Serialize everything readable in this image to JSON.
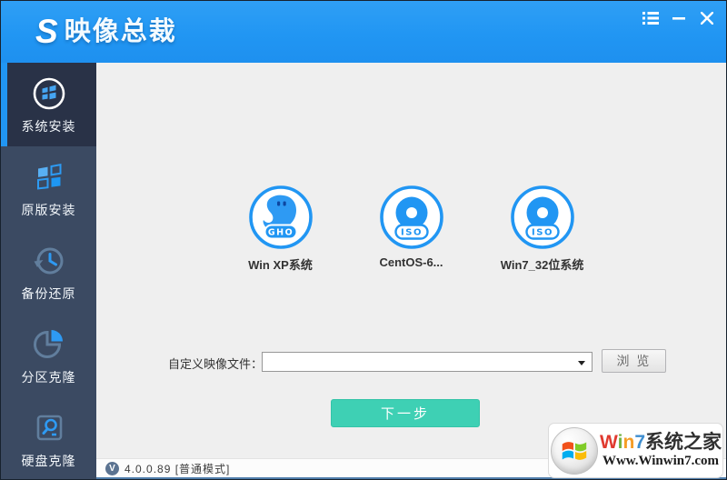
{
  "window": {
    "logo_letter": "S",
    "title": "映像总裁"
  },
  "titlebar": {
    "icons": [
      "menu-icon",
      "minimize-icon",
      "close-icon"
    ]
  },
  "sidebar": {
    "items": [
      {
        "label": "系统安装",
        "icon": "system-install-icon",
        "selected": true
      },
      {
        "label": "原版安装",
        "icon": "original-install-icon",
        "selected": false
      },
      {
        "label": "备份还原",
        "icon": "backup-restore-icon",
        "selected": false
      },
      {
        "label": "分区克隆",
        "icon": "partition-clone-icon",
        "selected": false
      },
      {
        "label": "硬盘克隆",
        "icon": "disk-clone-icon",
        "selected": false
      }
    ]
  },
  "main": {
    "files": [
      {
        "label": "Win XP系统",
        "badge": "GHO",
        "icon": "gho-file-icon"
      },
      {
        "label": "CentOS-6...",
        "badge": "ISO",
        "icon": "iso-file-icon"
      },
      {
        "label": "Win7_32位系统",
        "badge": "ISO",
        "icon": "iso-file-icon"
      }
    ],
    "form": {
      "label": "自定义映像文件：",
      "combo_value": "",
      "browse_label": "浏 览"
    },
    "next_label": "下一步"
  },
  "statusbar": {
    "badge": "V",
    "version": "4.0.0.89 [普通模式]"
  },
  "watermark": {
    "letters": [
      {
        "ch": "W",
        "color": "#e03a2f"
      },
      {
        "ch": "i",
        "color": "#72b342"
      },
      {
        "ch": "n",
        "color": "#f59d27"
      },
      {
        "ch": "7",
        "color": "#3e8ed0"
      }
    ],
    "suffix": "系统之家",
    "url": "Www.Winwin7.com"
  },
  "colors": {
    "titlebar_blue": "#2196f3",
    "sidebar_bg": "#3b4a62",
    "sidebar_selected_bg": "#293247",
    "accent_blue": "#2196f3",
    "next_button_green": "#3ed0b4",
    "main_bg": "#efefef",
    "status_badge": "#5b7391"
  }
}
